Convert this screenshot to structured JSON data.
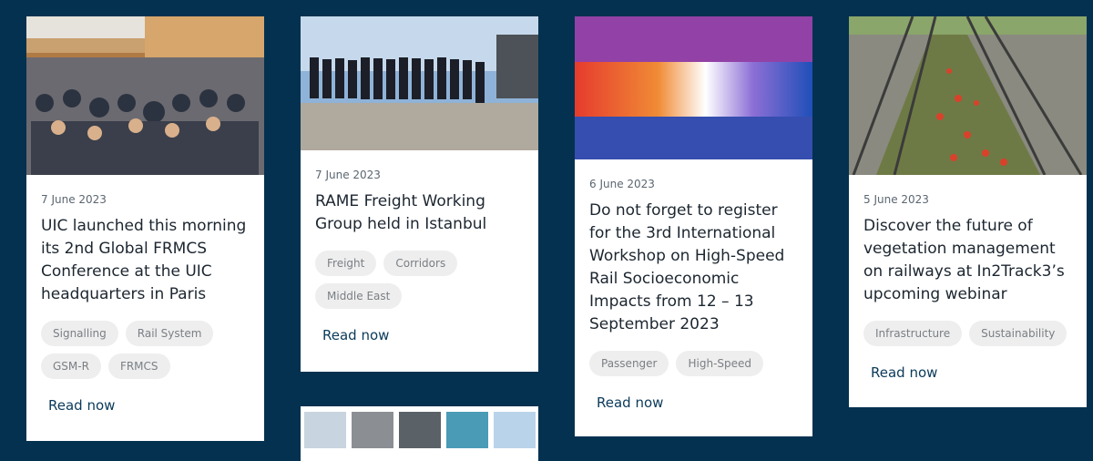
{
  "cards": [
    {
      "date": "7 June 2023",
      "title": "UIC launched this morning its 2nd Global FRMCS Conference at the UIC headquarters in Paris",
      "tags": [
        "Signalling",
        "Rail System",
        "GSM-R",
        "FRMCS"
      ],
      "read": "Read now"
    },
    {
      "date": "7 June 2023",
      "title": "RAME Freight Working Group held in Istanbul",
      "tags": [
        "Freight",
        "Corridors",
        "Middle East"
      ],
      "read": "Read now"
    },
    {
      "date": "6 June 2023",
      "title": "Do not forget to register for the 3rd International Workshop on High-Speed Rail Socioeconomic Impacts from 12 – 13 September 2023",
      "tags": [
        "Passenger",
        "High-Speed"
      ],
      "read": "Read now"
    },
    {
      "date": "5 June 2023",
      "title": "Discover the future of vegetation management on railways at In2Track3’s upcoming webinar",
      "tags": [
        "Infrastructure",
        "Sustainability"
      ],
      "read": "Read now"
    }
  ]
}
